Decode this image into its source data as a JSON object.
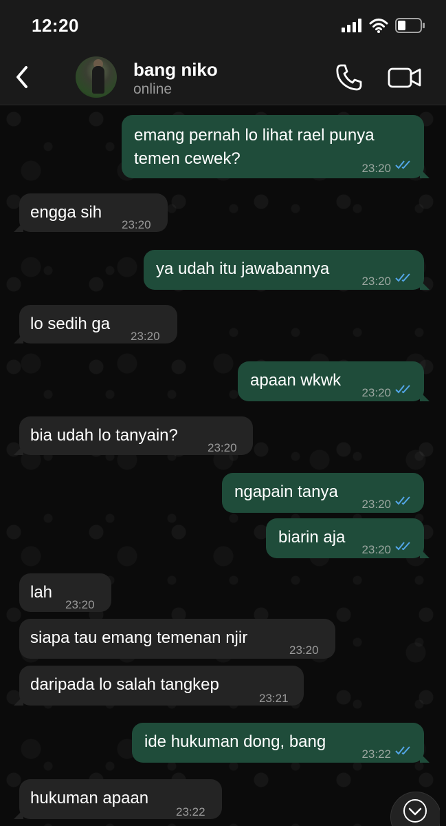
{
  "status_bar": {
    "time": "12:20"
  },
  "header": {
    "contact_name": "bang niko",
    "contact_status": "online"
  },
  "messages": [
    {
      "direction": "out",
      "lines": [
        "emang pernah lo lihat rael punya",
        "temen cewek?"
      ],
      "time": "23:20",
      "read": true
    },
    {
      "direction": "in",
      "lines": [
        "engga sih"
      ],
      "time": "23:20"
    },
    {
      "direction": "out",
      "lines": [
        "ya udah itu jawabannya"
      ],
      "time": "23:20",
      "read": true
    },
    {
      "direction": "in",
      "lines": [
        "lo sedih ga"
      ],
      "time": "23:20"
    },
    {
      "direction": "out",
      "lines": [
        "apaan wkwk"
      ],
      "time": "23:20",
      "read": true
    },
    {
      "direction": "in",
      "lines": [
        "bia udah lo tanyain?"
      ],
      "time": "23:20"
    },
    {
      "direction": "out",
      "lines": [
        "ngapain tanya"
      ],
      "time": "23:20",
      "read": true
    },
    {
      "direction": "out",
      "lines": [
        "biarin aja"
      ],
      "time": "23:20",
      "read": true
    },
    {
      "direction": "in",
      "lines": [
        "lah"
      ],
      "time": "23:20"
    },
    {
      "direction": "in",
      "lines": [
        "siapa tau emang temenan njir"
      ],
      "time": "23:20"
    },
    {
      "direction": "in",
      "lines": [
        "daripada lo salah tangkep"
      ],
      "time": "23:21"
    },
    {
      "direction": "out",
      "lines": [
        "ide hukuman dong, bang"
      ],
      "time": "23:22",
      "read": true
    },
    {
      "direction": "in",
      "lines": [
        "hukuman apaan"
      ],
      "time": "23:22"
    }
  ],
  "colors": {
    "outgoing_bubble": "#1f4c3a",
    "incoming_bubble": "#242424",
    "read_ticks": "#53a6e8"
  },
  "icons": [
    "back-chevron-icon",
    "phone-icon",
    "video-camera-icon",
    "signal-icon",
    "wifi-icon",
    "battery-icon",
    "chevron-down-icon"
  ]
}
